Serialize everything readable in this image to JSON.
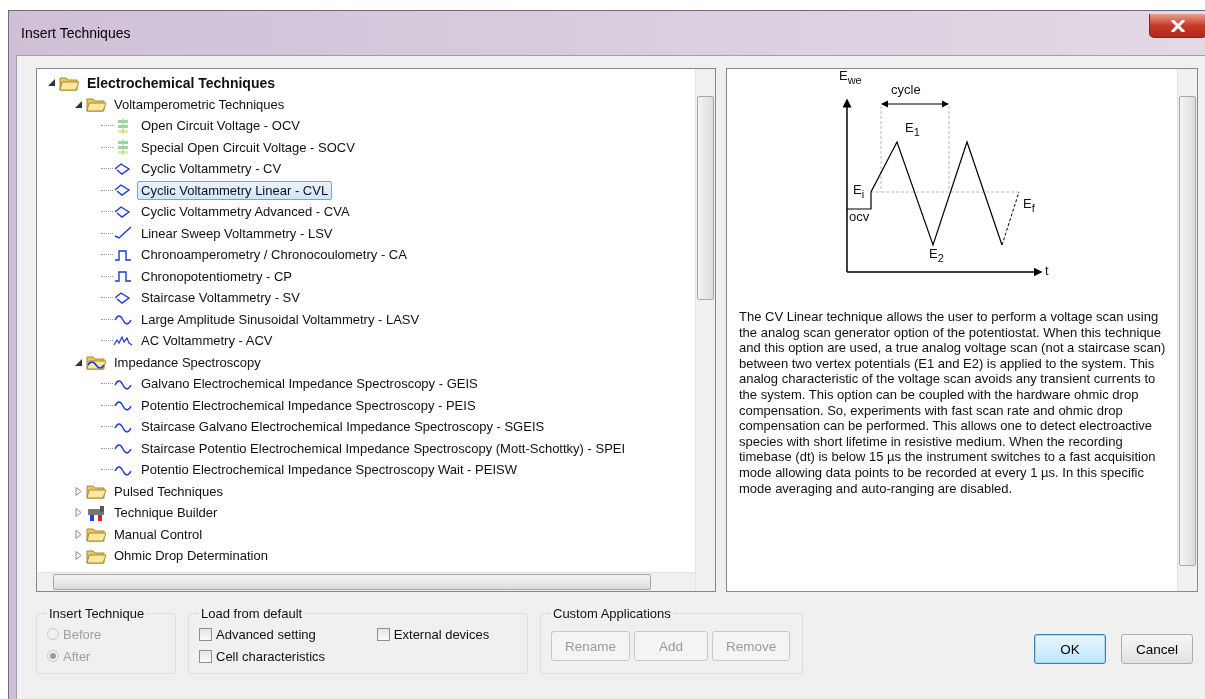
{
  "window": {
    "title": "Insert Techniques"
  },
  "tree": [
    {
      "label": "Electrochemical Techniques",
      "kind": "folder",
      "expanded": true,
      "selected": false,
      "children": [
        {
          "label": "Voltamperometric Techniques",
          "kind": "folder",
          "expanded": true,
          "selected": false,
          "children": [
            {
              "label": "Open Circuit Voltage - OCV",
              "kind": "ocv",
              "selected": false
            },
            {
              "label": "Special Open Circuit Voltage - SOCV",
              "kind": "ocv",
              "selected": false
            },
            {
              "label": "Cyclic Voltammetry - CV",
              "kind": "cv",
              "selected": false
            },
            {
              "label": "Cyclic Voltammetry Linear - CVL",
              "kind": "cv",
              "selected": true
            },
            {
              "label": "Cyclic Voltammetry Advanced - CVA",
              "kind": "cv",
              "selected": false
            },
            {
              "label": "Linear Sweep Voltammetry - LSV",
              "kind": "lsv",
              "selected": false
            },
            {
              "label": "Chronoamperometry / Chronocoulometry - CA",
              "kind": "step",
              "selected": false
            },
            {
              "label": "Chronopotentiometry - CP",
              "kind": "step",
              "selected": false
            },
            {
              "label": "Staircase Voltammetry - SV",
              "kind": "cv",
              "selected": false
            },
            {
              "label": "Large Amplitude Sinusoidal Voltammetry - LASV",
              "kind": "sine",
              "selected": false
            },
            {
              "label": "AC Voltammetry - ACV",
              "kind": "ac",
              "selected": false
            }
          ]
        },
        {
          "label": "Impedance Spectroscopy",
          "kind": "eis-folder",
          "expanded": true,
          "selected": false,
          "children": [
            {
              "label": "Galvano Electrochemical Impedance Spectroscopy - GEIS",
              "kind": "sine",
              "selected": false
            },
            {
              "label": "Potentio Electrochemical Impedance Spectroscopy - PEIS",
              "kind": "sine",
              "selected": false
            },
            {
              "label": "Staircase Galvano Electrochemical Impedance Spectroscopy - SGEIS",
              "kind": "sine",
              "selected": false
            },
            {
              "label": "Staircase Potentio Electrochemical Impedance Spectroscopy (Mott-Schottky) - SPEI",
              "kind": "sine",
              "selected": false
            },
            {
              "label": "Potentio Electrochemical Impedance Spectroscopy Wait - PEISW",
              "kind": "sine",
              "selected": false
            }
          ]
        },
        {
          "label": "Pulsed Techniques",
          "kind": "folder",
          "expanded": false,
          "selected": false
        },
        {
          "label": "Technique Builder",
          "kind": "builder",
          "expanded": false,
          "selected": false
        },
        {
          "label": "Manual Control",
          "kind": "folder",
          "expanded": false,
          "selected": false
        },
        {
          "label": "Ohmic Drop Determination",
          "kind": "folder",
          "expanded": false,
          "selected": false
        }
      ]
    }
  ],
  "diagram": {
    "labels": [
      "E$_{we}$",
      "cycle",
      "E$_{1}$",
      "E$_{i}$",
      "E$_{f}$",
      "ocv",
      "E$_{2}$",
      "t"
    ]
  },
  "description": "The CV Linear technique allows the user to perform a voltage scan using the analog scan generator option of the potentiostat. When this technique and this option are used, a true analog voltage scan (not a staircase scan) between two vertex potentials (E1 and E2) is applied to the system. This analog characteristic of the voltage scan avoids any transient currents to the system. This option can be coupled with the hardware ohmic drop compensation. So, experiments with fast scan rate and ohmic drop compensation can be performed. This allows one to detect electroactive species with short lifetime in resistive medium. When the recording timebase (dt) is below 15 µs the instrument switches to a fast acquisition mode allowing data points to be recorded at every 1 µs. In this specific mode averaging and auto-ranging are disabled.",
  "insert_technique": {
    "title": "Insert Technique",
    "options": [
      {
        "label": "Before",
        "selected": false,
        "disabled": true
      },
      {
        "label": "After",
        "selected": true,
        "disabled": true
      }
    ]
  },
  "load_from_default": {
    "title": "Load from default",
    "options": [
      {
        "label": "Advanced setting",
        "checked": false
      },
      {
        "label": "External devices",
        "checked": false
      },
      {
        "label": "Cell characteristics",
        "checked": false
      }
    ]
  },
  "custom_applications": {
    "title": "Custom Applications",
    "buttons": [
      {
        "label": "Rename",
        "disabled": true
      },
      {
        "label": "Add",
        "disabled": true
      },
      {
        "label": "Remove",
        "disabled": true
      }
    ]
  },
  "buttons": [
    {
      "label": "OK",
      "kind": "default"
    },
    {
      "label": "Cancel",
      "kind": "normal"
    }
  ]
}
